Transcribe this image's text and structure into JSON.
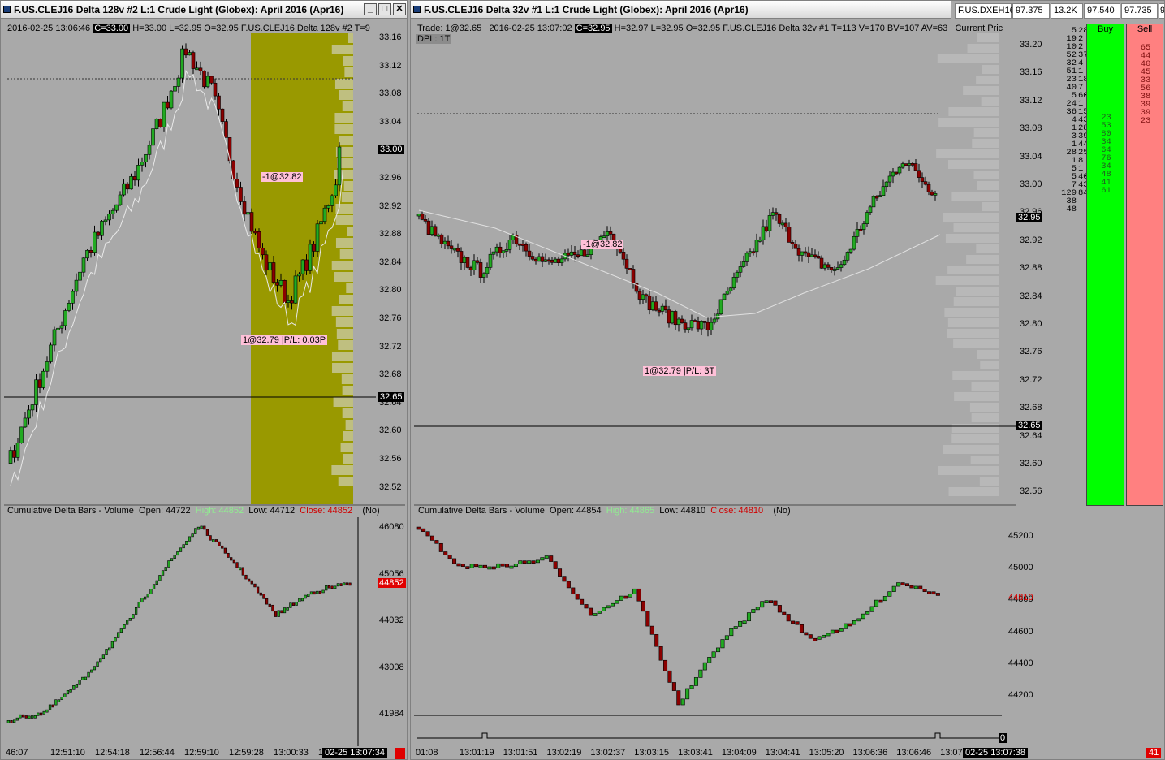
{
  "left": {
    "title": "F.US.CLEJ16  Delta 128v  #2  L:1  Crude Light (Globex): April 2016 (Apr16)",
    "info": {
      "datetime": "2016-02-25  13:06:46",
      "close_box": "C=33.00",
      "rest": "H=33.00  L=32.95  O=32.95  F.US.CLEJ16  Delta 128v  #2  T=9"
    },
    "price_axis": [
      "33.16",
      "33.12",
      "33.08",
      "33.04",
      "33.00",
      "32.96",
      "32.92",
      "32.88",
      "32.84",
      "32.80",
      "32.76",
      "32.72",
      "32.68",
      "32.64",
      "32.60",
      "32.56",
      "32.52"
    ],
    "current_price": "33.00",
    "crosshair_price": "32.65",
    "trade_tags": [
      "-1@32.82",
      "1@32.79 |P/L: 0.03P"
    ],
    "delta_panel": {
      "label": "Cumulative Delta Bars - Volume",
      "open": "Open: 44722",
      "high": "High: 44852",
      "low": "Low: 44712",
      "close": "Close: 44852",
      "flag": "(No)",
      "axis": [
        "46080",
        "45056",
        "44032",
        "43008",
        "41984"
      ],
      "current": "44852"
    },
    "time_axis": [
      "46:07",
      "12:51:10",
      "12:54:18",
      "12:56:44",
      "12:59:10",
      "12:59:28",
      "13:00:33",
      "13:0"
    ],
    "date_box": "02-25  13:07:34"
  },
  "right": {
    "title": "F.US.CLEJ16  Delta 32v  #1  L:1  Crude Light (Globex): April 2016 (Apr16)",
    "info": {
      "trade": "Trade: 1@32.65",
      "datetime": "2016-02-25  13:07:02",
      "close_box": "C=32.95",
      "rest": "H=32.97  L=32.95  O=32.95  F.US.CLEJ16  Delta 32v  #1  T=113  V=170  BV=107  AV=63",
      "current_price_label": "Current Pric"
    },
    "dpl": "DPL: 1T",
    "price_axis": [
      "33.20",
      "33.16",
      "33.12",
      "33.08",
      "33.04",
      "33.00",
      "32.96",
      "32.92",
      "32.88",
      "32.84",
      "32.80",
      "32.76",
      "32.72",
      "32.68",
      "32.64",
      "32.60",
      "32.56"
    ],
    "current_price": "32.95",
    "crosshair_price": "32.65",
    "trade_tags": [
      "-1@32.82",
      "1@32.79 |P/L: 3T"
    ],
    "delta_panel": {
      "label": "Cumulative Delta Bars - Volume",
      "open": "Open: 44854",
      "high": "High: 44865",
      "low": "Low: 44810",
      "close": "Close: 44810",
      "flag": "(No)",
      "axis": [
        "45200",
        "45000",
        "44800",
        "44600",
        "44400",
        "44200"
      ],
      "current": "44810"
    },
    "time_axis": [
      "01:08",
      "13:01:19",
      "13:01:51",
      "13:02:19",
      "13:02:37",
      "13:03:15",
      "13:03:41",
      "13:04:09",
      "13:04:41",
      "13:05:20",
      "13:06:36",
      "13:06:46",
      "13:07:"
    ],
    "date_box": "02-25  13:07:38",
    "zero_label": "0"
  },
  "quote_bar": {
    "symbol": "F.US.DXEH16",
    "last": "97.375",
    "volume": "13.2K",
    "bid": "97.540",
    "ask": "97.735",
    "extra": "97"
  },
  "dom": {
    "buy_header": "Buy",
    "sell_header": "Sell",
    "sell_col": [
      "65",
      "44",
      "40",
      "45",
      "33",
      "56",
      "38",
      "39",
      "39",
      "23"
    ],
    "buy_col": [
      "23",
      "53",
      "80",
      "34",
      "64",
      "76",
      "34",
      "48",
      "41",
      "61"
    ],
    "left_col1": [
      "5",
      "19",
      "10",
      "52",
      "32",
      "51",
      "23",
      "40",
      "5",
      "24",
      "36",
      "4",
      "1",
      "3",
      "1",
      "28",
      "1",
      "5",
      "5",
      "7",
      "129",
      "38",
      "48"
    ],
    "left_col2": [
      "28",
      "2",
      "2",
      "37",
      "4",
      "1",
      "18",
      "7",
      "60",
      "1",
      "15",
      "43",
      "28",
      "39",
      "44",
      "25",
      "8",
      "1",
      "40",
      "43",
      "84",
      "",
      ""
    ],
    "bottom_badge": "41"
  },
  "colors": {
    "up_candle": "#22aa22",
    "down_candle": "#8b0000",
    "highlight_zone": "#999900",
    "buy_green": "#00ff00",
    "sell_red": "#ff8080",
    "chart_bg": "#a9a9a9"
  }
}
